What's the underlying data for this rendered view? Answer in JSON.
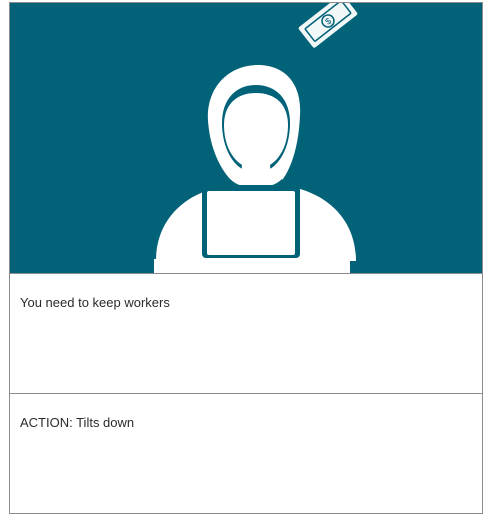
{
  "storyboard": {
    "scene_background": "#026278",
    "figure_color": "#ffffff",
    "money_icon_color": "#ffffff",
    "line_text": "You need to keep workers",
    "action_text": "ACTION:  Tilts down"
  }
}
